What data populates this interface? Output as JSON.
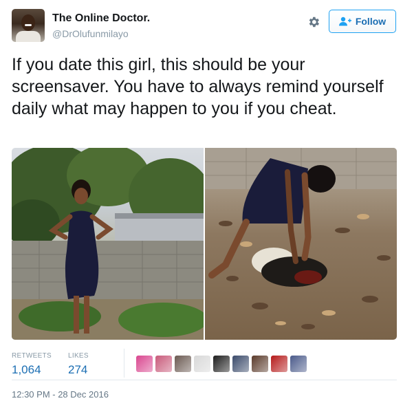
{
  "user": {
    "name": "The Online Doctor.",
    "handle": "@DrOlufunmilayo"
  },
  "header": {
    "settings_icon": "gear-icon",
    "follow_label": "Follow",
    "follow_icon": "add-user-icon",
    "accent_color": "#1da1f2"
  },
  "tweet": {
    "text": "If you date this girl, this should be your screensaver. You have to always remind yourself daily what may happen to you if you cheat."
  },
  "stats": {
    "retweets_label": "RETWEETS",
    "retweets_value": "1,064",
    "likes_label": "LIKES",
    "likes_value": "274"
  },
  "likers": [
    {
      "color": "#d9468f"
    },
    {
      "color": "#c85a7a"
    },
    {
      "color": "#6b5a52"
    },
    {
      "color": "#d8d8d8"
    },
    {
      "color": "#1d1d1d"
    },
    {
      "color": "#3a4a6a"
    },
    {
      "color": "#5a3a2a"
    },
    {
      "color": "#b51a1a"
    },
    {
      "color": "#4a5a8a"
    }
  ],
  "timestamp": "12:30 PM - 28 Dec 2016"
}
